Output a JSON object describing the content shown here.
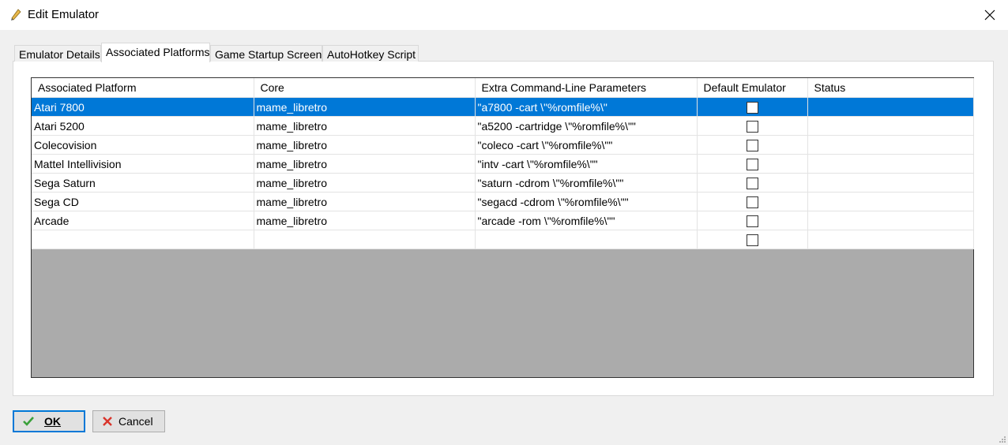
{
  "window": {
    "title": "Edit Emulator"
  },
  "tabs": [
    {
      "label": "Emulator Details",
      "active": false
    },
    {
      "label": "Associated Platforms",
      "active": true
    },
    {
      "label": "Game Startup Screen",
      "active": false
    },
    {
      "label": "AutoHotkey Script",
      "active": false
    }
  ],
  "grid": {
    "columns": [
      "Associated Platform",
      "Core",
      "Extra Command-Line Parameters",
      "Default Emulator",
      "Status"
    ],
    "rows": [
      {
        "platform": "Atari 7800",
        "core": "mame_libretro",
        "params": "\"a7800 -cart \\\"%romfile%\\\"",
        "default": false,
        "status": "",
        "selected": true
      },
      {
        "platform": "Atari 5200",
        "core": "mame_libretro",
        "params": "\"a5200 -cartridge \\\"%romfile%\\\"\"",
        "default": false,
        "status": ""
      },
      {
        "platform": "Colecovision",
        "core": "mame_libretro",
        "params": "\"coleco -cart \\\"%romfile%\\\"\"",
        "default": false,
        "status": ""
      },
      {
        "platform": "Mattel Intellivision",
        "core": "mame_libretro",
        "params": "\"intv -cart \\\"%romfile%\\\"\"",
        "default": false,
        "status": ""
      },
      {
        "platform": "Sega Saturn",
        "core": "mame_libretro",
        "params": "\"saturn -cdrom \\\"%romfile%\\\"\"",
        "default": false,
        "status": ""
      },
      {
        "platform": "Sega CD",
        "core": "mame_libretro",
        "params": "\"segacd -cdrom \\\"%romfile%\\\"\"",
        "default": false,
        "status": ""
      },
      {
        "platform": "Arcade",
        "core": "mame_libretro",
        "params": "\"arcade -rom \\\"%romfile%\\\"\"",
        "default": false,
        "status": ""
      },
      {
        "platform": "",
        "core": "",
        "params": "",
        "default": false,
        "status": ""
      }
    ]
  },
  "buttons": {
    "ok_label": "OK",
    "cancel_label": "Cancel"
  },
  "colors": {
    "selection": "#0078d7",
    "grid_empty": "#ababab"
  }
}
